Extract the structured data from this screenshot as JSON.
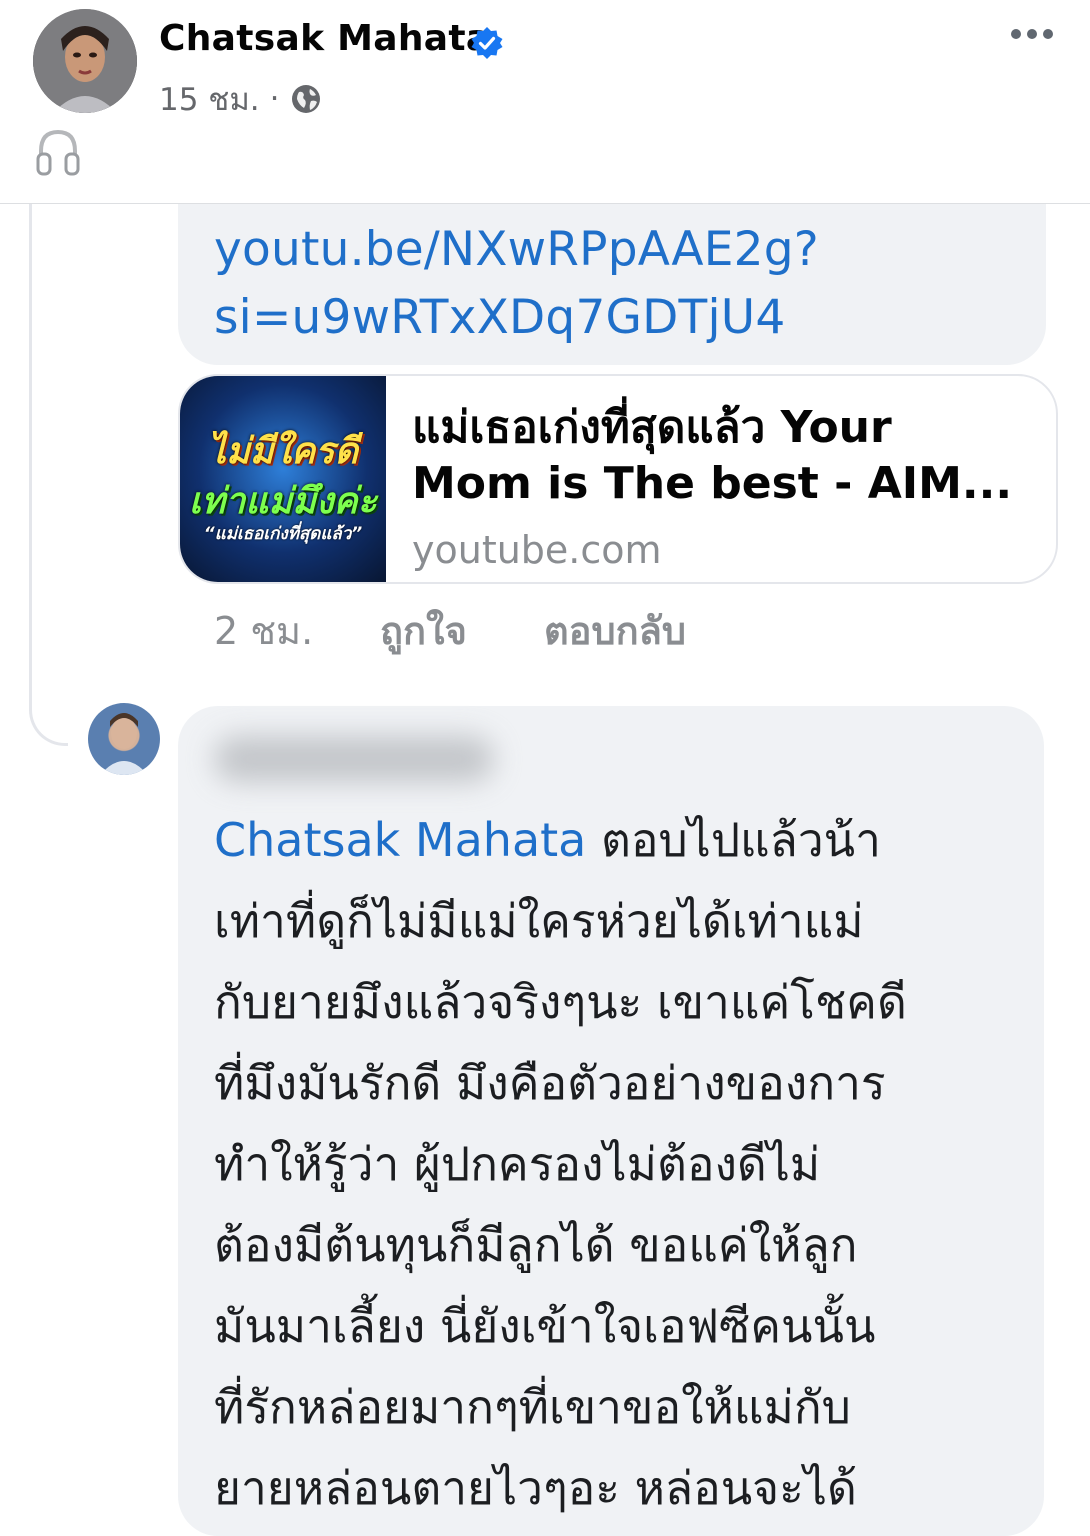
{
  "post": {
    "author_name": "Chatsak Mahata",
    "time": "15 ชม.",
    "separator": "·"
  },
  "comment_link": {
    "url_line_1": "youtu.be/NXwRPpAAE2g?",
    "url_line_2": "si=u9wRTxXDq7GDTjU4",
    "card": {
      "thumb_line_1": "ไม่มีใครดี",
      "thumb_line_2": "เท่าแม่มึงค่ะ",
      "thumb_line_3": "“แม่เธอเก่งที่สุดแล้ว”",
      "title_line_1": "แม่เธอเก่งที่สุดแล้ว Your",
      "title_line_2": "Mom is The best - AIM...",
      "domain": "youtube.com"
    },
    "actions": {
      "time": "2 ชม.",
      "like": "ถูกใจ",
      "reply": "ตอบกลับ"
    }
  },
  "reply_comment": {
    "mention": "Chatsak Mahata",
    "lines": [
      " ตอบไปแล้วน้า",
      "เท่าที่ดูก็ไม่มีแม่ใครห่วยได้เท่าแม่",
      "กับยายมึงแล้วจริงๆนะ เขาแค่โชคดี",
      "ที่มึงมันรักดี มึงคือตัวอย่างของการ",
      "ทำให้รู้ว่า ผู้ปกครองไม่ต้องดีไม่",
      "ต้องมีต้นทุนก็มีลูกได้ ขอแค่ให้ลูก",
      "มันมาเลี้ยง นี่ยังเข้าใจเอฟซีคนนั้น",
      "ที่รักหล่อยมากๆที่เขาขอให้แม่กับ",
      "ยายหล่อนตายไวๆอะ หล่อนจะได้"
    ]
  },
  "colors": {
    "link_blue": "#1f6fc9",
    "verified_blue": "#1877f2",
    "bubble_gray": "#f0f2f5",
    "meta_gray": "#65676b"
  },
  "icons": [
    "verified-badge-icon",
    "globe-icon",
    "more-options-icon",
    "headphones-icon"
  ]
}
